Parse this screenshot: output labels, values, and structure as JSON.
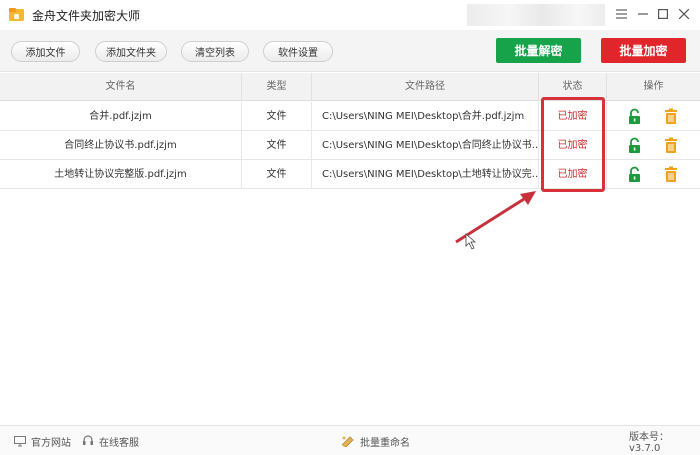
{
  "app": {
    "title": "金舟文件夹加密大师"
  },
  "toolbar": {
    "add_file": "添加文件",
    "add_folder": "添加文件夹",
    "clear_list": "清空列表",
    "settings": "软件设置",
    "batch_decrypt": "批量解密",
    "batch_encrypt": "批量加密",
    "colors": {
      "decrypt": "#17a34a",
      "encrypt": "#e0262b"
    }
  },
  "table": {
    "headers": {
      "name": "文件名",
      "type": "类型",
      "path": "文件路径",
      "status": "状态",
      "ops": "操作"
    },
    "rows": [
      {
        "name": "合并.pdf.jzjm",
        "type": "文件",
        "path": "C:\\Users\\NING MEI\\Desktop\\合并.pdf.jzjm",
        "status": "已加密"
      },
      {
        "name": "合同终止协议书.pdf.jzjm",
        "type": "文件",
        "path": "C:\\Users\\NING MEI\\Desktop\\合同终止协议书...",
        "status": "已加密"
      },
      {
        "name": "土地转让协议完整版.pdf.jzjm",
        "type": "文件",
        "path": "C:\\Users\\NING MEI\\Desktop\\土地转让协议完...",
        "status": "已加密"
      }
    ],
    "status_color": "#d12b2b"
  },
  "footer": {
    "official_site": "官方网站",
    "online_service": "在线客服",
    "batch_rename": "批量重命名",
    "version": "版本号：v3.7.0"
  },
  "icons": [
    "folder-logo-icon",
    "minimize-icon",
    "menu-icon",
    "maximize-icon",
    "close-icon",
    "unlock-icon",
    "trash-icon",
    "monitor-icon",
    "headset-icon",
    "rename-icon",
    "arrow-annotation"
  ]
}
